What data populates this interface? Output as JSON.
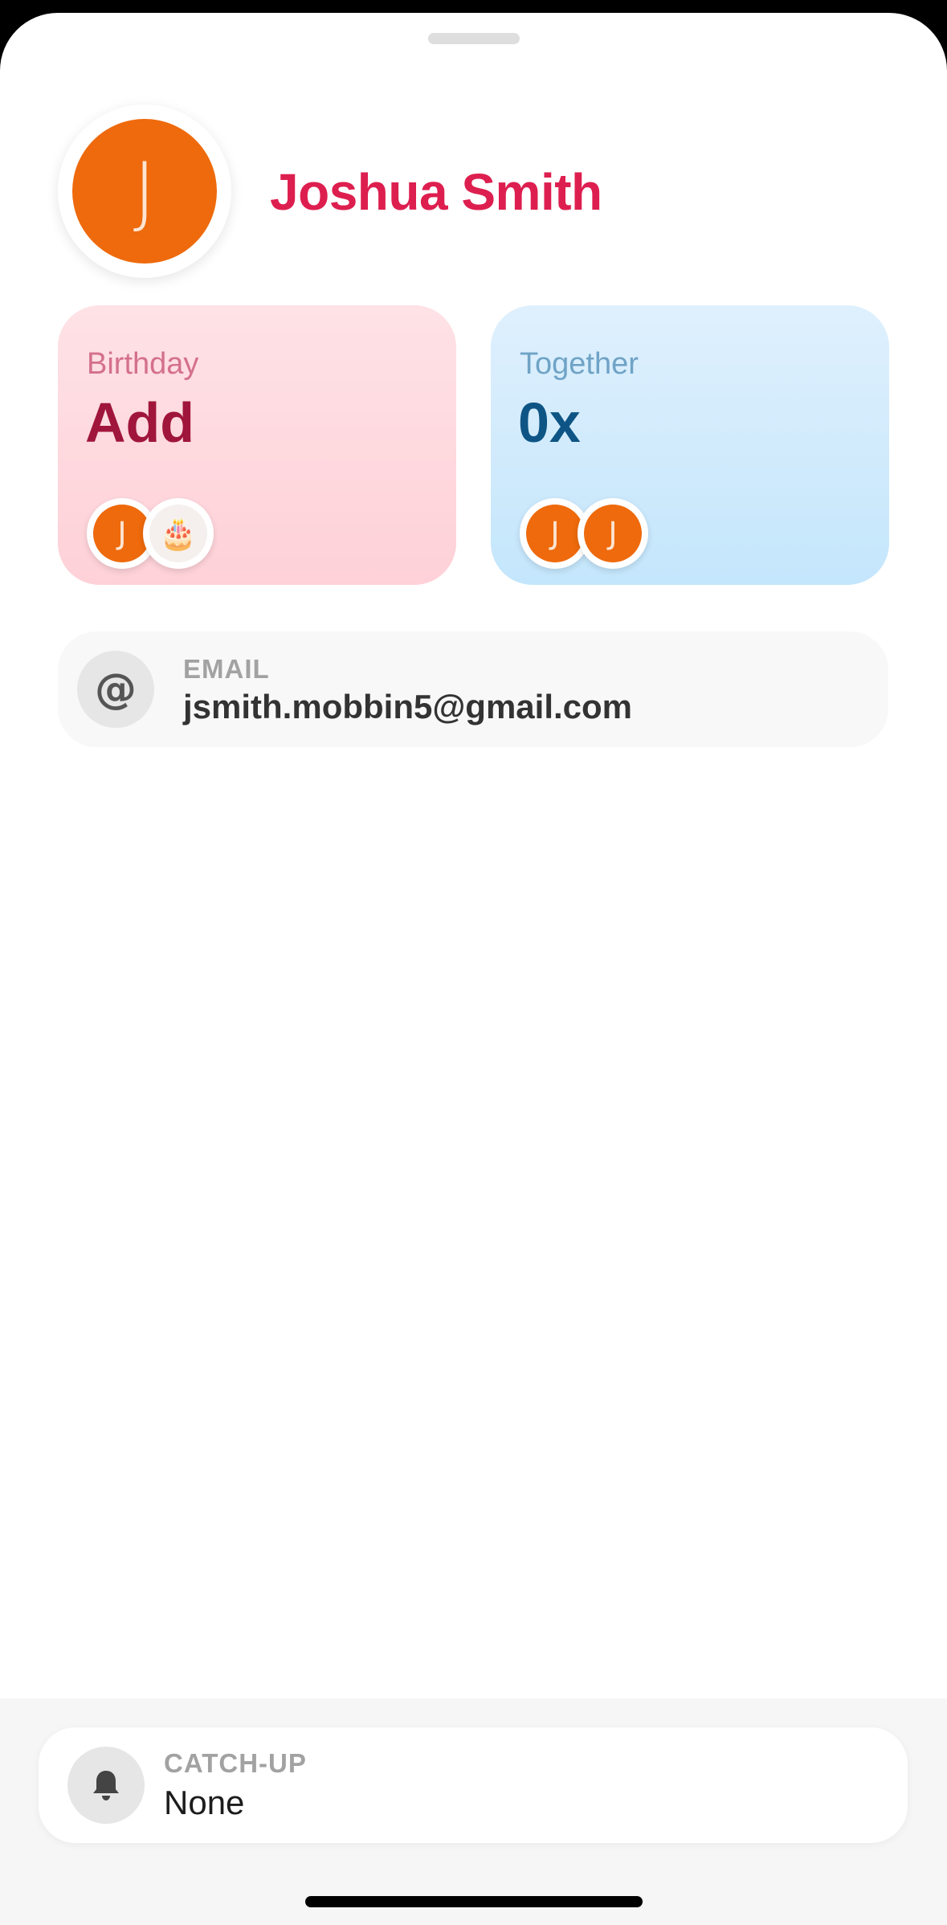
{
  "profile": {
    "initial": "J",
    "name": "Joshua Smith",
    "avatar_color": "#ee6a0c",
    "name_color": "#dd1f4f"
  },
  "birthday_card": {
    "label": "Birthday",
    "value": "Add",
    "avatars": [
      "J",
      "🎂"
    ]
  },
  "together_card": {
    "label": "Together",
    "value": "0x",
    "avatars": [
      "J",
      "J"
    ]
  },
  "email": {
    "icon": "at-sign-icon",
    "glyph": "@",
    "label": "EMAIL",
    "value": "jsmith.mobbin5@gmail.com"
  },
  "catchup": {
    "icon": "bell-icon",
    "label": "CATCH-UP",
    "value": "None"
  }
}
